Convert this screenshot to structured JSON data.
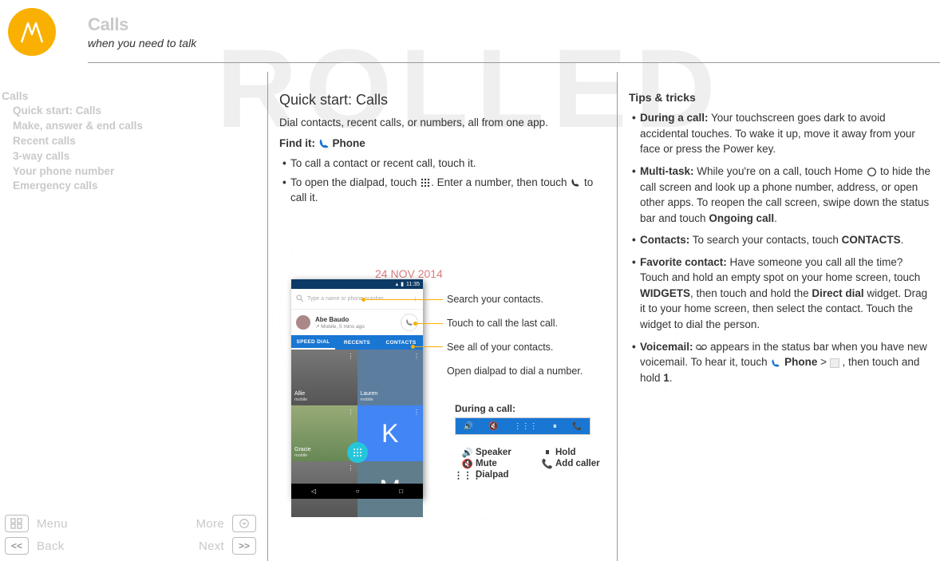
{
  "header": {
    "title": "Calls",
    "subtitle": "when you need to talk"
  },
  "watermark_date": "24 NOV 2014",
  "nav": {
    "section": "Calls",
    "items": [
      "Quick start: Calls",
      "Make, answer & end calls",
      "Recent calls",
      "3-way calls",
      "Your phone number",
      "Emergency calls"
    ]
  },
  "center": {
    "heading": "Quick start: Calls",
    "intro": "Dial contacts, recent calls, or numbers, all from one app.",
    "findit_label": "Find it:",
    "findit_app": "Phone",
    "bullets": [
      "To call a contact or recent call, touch it.",
      "To open the dialpad, touch ⋮⋮⋮. Enter a number, then touch 📞 to call it."
    ],
    "bullets_text": {
      "b2_pre": "To open the dialpad, touch ",
      "b2_mid": ". Enter a number, then touch ",
      "b2_post": " to call it."
    }
  },
  "callouts": {
    "c1": "Search your contacts.",
    "c2": "Touch to call the last call.",
    "c3": "See all of your contacts.",
    "c4": "Open dialpad to dial a number."
  },
  "phone": {
    "time": "11:35",
    "search_placeholder": "Type a name or phone number",
    "last_call_name": "Abe Baudo",
    "last_call_sub": "Mobile, 5 mins ago",
    "tabs": [
      "SPEED DIAL",
      "RECENTS",
      "CONTACTS"
    ],
    "tiles": [
      {
        "name": "Allie",
        "sub": "mobile",
        "cls": "a"
      },
      {
        "name": "Lauren",
        "sub": "mobile",
        "cls": "l"
      },
      {
        "name": "Gracie",
        "sub": "mobile",
        "cls": "g"
      },
      {
        "name": "K",
        "sub": "",
        "cls": "k"
      },
      {
        "name": "",
        "sub": "",
        "cls": "a"
      },
      {
        "name": "M",
        "sub": "",
        "cls": "m"
      }
    ]
  },
  "during_call": {
    "title": "During a call:",
    "opts": [
      {
        "icon": "🔊",
        "label": "Speaker"
      },
      {
        "icon": "⏸",
        "label": "Hold"
      },
      {
        "icon": "🔇",
        "label": "Mute"
      },
      {
        "icon": "📞",
        "label": "Add caller"
      },
      {
        "icon": "⋮⋮⋮",
        "label": "Dialpad"
      }
    ]
  },
  "right": {
    "heading": "Tips & tricks",
    "tips": [
      {
        "bold": "During a call:",
        "text": " Your touchscreen goes dark to avoid accidental touches. To wake it up, move it away from your face or press the Power key."
      },
      {
        "bold": "Multi-task:",
        "text_pre": " While you're on a call, touch Home ",
        "text_post": " to hide the call screen and look up a phone number, address, or open other apps. To reopen the call screen, swipe down the status bar and touch ",
        "text_end": "Ongoing call",
        "period": "."
      },
      {
        "bold": "Contacts:",
        "text": " To search your contacts, touch ",
        "strong": "CONTACTS",
        "period": "."
      },
      {
        "bold": "Favorite contact:",
        "text_a": " Have someone you call all the time? Touch and hold an empty spot on your home screen, touch ",
        "strong_a": "WIDGETS",
        "text_b": ", then touch and hold the ",
        "strong_b": "Direct dial",
        "text_c": "  widget. Drag it to your home screen, then select the contact. Touch the widget to dial the person."
      },
      {
        "bold": "Voicemail:",
        "text_a": " ",
        "text_b": " appears in the status bar when you have new voicemail. To hear it, touch ",
        "strong_a": "Phone",
        "arrow": " > ",
        "text_c": " , then touch and hold ",
        "strong_b": "1",
        "period": "."
      }
    ]
  },
  "controls": {
    "menu": "Menu",
    "more": "More",
    "back": "Back",
    "next": "Next"
  }
}
